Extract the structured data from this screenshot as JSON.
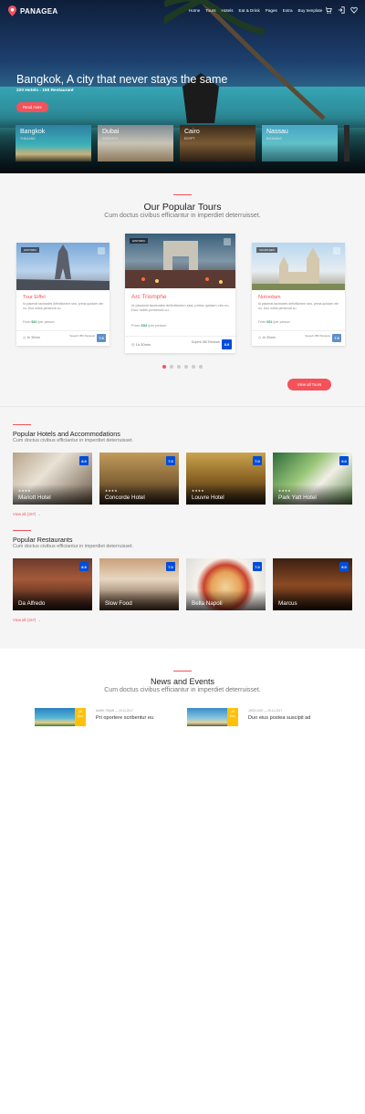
{
  "brand": {
    "name": "PANAGEA",
    "accent": "#f3525b",
    "score_blue": "#004dda"
  },
  "nav": {
    "items": [
      "Home",
      "Tours",
      "Hotels",
      "Eat & Drink",
      "Pages",
      "Extra",
      "Buy template"
    ]
  },
  "hero": {
    "title": "Bangkok, A city that never stays the same",
    "subtitle": "220 Hotels - 150 Restaurant",
    "button": "Read more",
    "cities": [
      {
        "name": "Bangkok",
        "country": "THAILAND"
      },
      {
        "name": "Dubai",
        "country": "EMIRATES"
      },
      {
        "name": "Cairo",
        "country": "EGYPT"
      },
      {
        "name": "Nassau",
        "country": "BAHAMAS"
      }
    ]
  },
  "tours": {
    "title": "Our Popular Tours",
    "subtitle": "Cum doctus civibus efficiantur in imperdiet deterruisset.",
    "cards": [
      {
        "tag": "HISTORIC",
        "name": "Tour Eiffel",
        "desc": "Id placerat tacimates definitionem sea, prima quidam vim no. Duo nobis persecuti cu.",
        "price_prefix": "From",
        "price": "$54",
        "price_suffix": "/per person",
        "duration": "1h 30min",
        "superb": "Superb 350 Reviews",
        "score": "7.5"
      },
      {
        "tag": "HISTORIC",
        "name": "Arc Triomphe",
        "desc": "Id placerat tacimates definitionem sea, prima quidam vim no. Duo nobis persecuti cu.",
        "price_prefix": "From",
        "price": "$54",
        "price_suffix": "/per person",
        "duration": "1h 30min",
        "superb": "Superb 350 Reviews",
        "score": "8.9"
      },
      {
        "tag": "CHURCHES",
        "name": "Notredam",
        "desc": "Id placerat tacimates definitionem sea, prima quidam vim no. Duo nobis persecuti cu.",
        "price_prefix": "From",
        "price": "$54",
        "price_suffix": "/per person",
        "duration": "1h 30min",
        "superb": "Superb 350 Reviews",
        "score": "7.5"
      }
    ],
    "view_all": "View all Tours"
  },
  "hotels": {
    "title": "Popular Hotels and Accommodations",
    "subtitle": "Cum doctus civibus efficiantur in imperdiet deterruisset.",
    "items": [
      {
        "name": "Mariott Hotel",
        "score": "8.9",
        "stars": "★★★★"
      },
      {
        "name": "Concorde Hotel",
        "score": "7.0",
        "stars": "★★★★"
      },
      {
        "name": "Louvre Hotel",
        "score": "7.0",
        "stars": "★★★★"
      },
      {
        "name": "Park Yatt Hotel",
        "score": "9.0",
        "stars": "★★★★"
      }
    ],
    "view_all": "View all (157) →"
  },
  "restaurants": {
    "title": "Popular Restaurants",
    "subtitle": "Cum doctus civibus efficiantur in imperdiet deterruisset.",
    "items": [
      {
        "name": "Da Alfredo",
        "score": "8.9"
      },
      {
        "name": "Slow Food",
        "score": "7.0"
      },
      {
        "name": "Bella Napoli",
        "score": "7.0"
      },
      {
        "name": "Marcus",
        "score": "9.0"
      }
    ],
    "view_all": "View all (157) →"
  },
  "news": {
    "title": "News and Events",
    "subtitle": "Cum doctus civibus efficiantur in imperdiet deterruisset.",
    "items": [
      {
        "day": "28",
        "month": "Dec",
        "meta": "MARK TWAIN  —  20.11.2017",
        "title": "Pri oportere scribentur eu"
      },
      {
        "day": "28",
        "month": "Dec",
        "meta": "JHON DOE  —  20.11.2017",
        "title": "Duo eius postea suscipit ad"
      }
    ]
  }
}
